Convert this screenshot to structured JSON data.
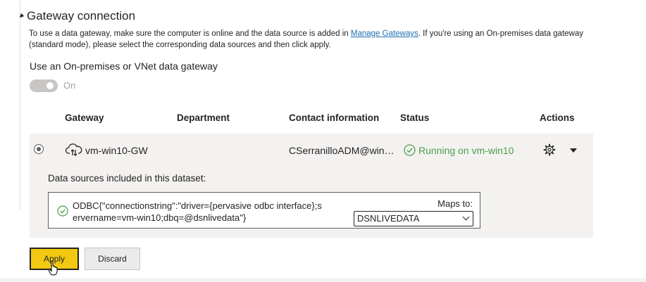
{
  "section": {
    "title": "Gateway connection"
  },
  "description": {
    "text_before": "To use a data gateway, make sure the computer is online and the data source is added in ",
    "link": "Manage Gateways",
    "text_after": ". If you're using an On-premises data gateway (standard mode), please select the corresponding data sources and then click apply."
  },
  "onprem": {
    "label": "Use an On-premises or VNet data gateway",
    "toggle_state": "On"
  },
  "table": {
    "headers": {
      "gateway": "Gateway",
      "department": "Department",
      "contact": "Contact information",
      "status": "Status",
      "actions": "Actions"
    },
    "row": {
      "gateway": "vm-win10-GW",
      "department": "",
      "contact": "CSerranilloADM@wind...",
      "status": "Running on vm-win10",
      "status_color": "#4c9f4c"
    }
  },
  "datasources": {
    "heading": "Data sources included in this dataset:",
    "connection": "ODBC{\"connectionstring\":\"driver={pervasive odbc interface};servername=vm-win10;dbq=@dsnlivedata\"}",
    "maps_to_label": "Maps to:",
    "maps_to_value": "DSNLIVEDATA"
  },
  "buttons": {
    "apply": "Apply",
    "discard": "Discard"
  },
  "colors": {
    "accent": "#f2c811",
    "link": "#1f6fb2",
    "success": "#4c9f4c"
  }
}
